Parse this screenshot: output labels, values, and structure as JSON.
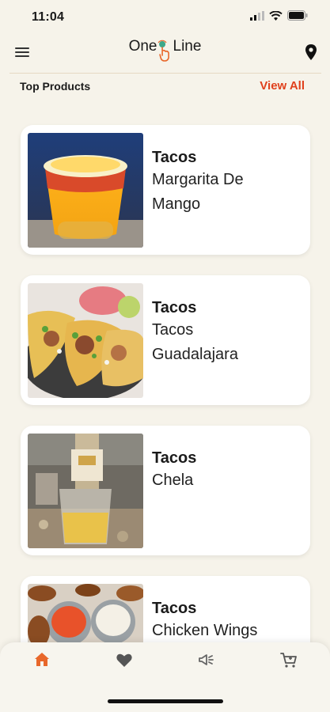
{
  "status_bar": {
    "time": "11:04"
  },
  "header": {
    "logo_left": "One",
    "logo_right": "Line"
  },
  "section": {
    "title": "Top Products",
    "view_all": "View All"
  },
  "products": [
    {
      "category": "Tacos",
      "name": "Margarita De Mango",
      "image": "mango-margarita-photo"
    },
    {
      "category": "Tacos",
      "name": "Tacos Guadalajara",
      "image": "tacos-photo"
    },
    {
      "category": "Tacos",
      "name": "Chela",
      "image": "beer-photo"
    },
    {
      "category": "Tacos",
      "name": "Chicken Wings",
      "image": "chicken-wings-photo"
    }
  ],
  "tabbar": {
    "items": [
      "home-icon",
      "heart-icon",
      "megaphone-icon",
      "cart-icon"
    ],
    "active": "home-icon"
  },
  "colors": {
    "accent": "#e0401c",
    "background": "#f6f3ea",
    "active_tab": "#e8672a"
  }
}
